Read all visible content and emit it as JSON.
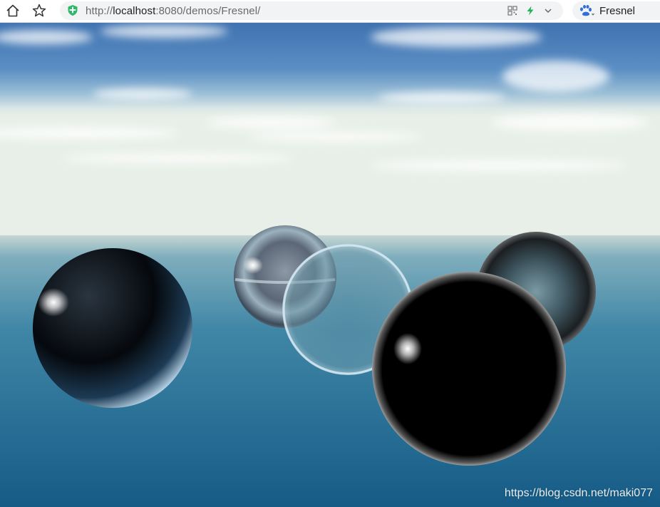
{
  "toolbar": {
    "home_icon": "home-icon",
    "favorite_icon": "star-icon",
    "security_icon": "shield-check-icon",
    "url_scheme": "http://",
    "url_host": "localhost",
    "url_rest": ":8080/demos/Fresnel/",
    "qr_icon": "qr-code-icon",
    "accelerate_icon": "lightning-icon",
    "dropdown_icon": "chevron-down-icon",
    "search_engine_icon": "baidu-paw-icon",
    "search_text": "Fresnel"
  },
  "scene": {
    "description_icon": "webgl-canvas",
    "sky_top": "#3f72b0",
    "sky_horizon": "#e8efe8",
    "water_far": "#6b9fb0",
    "water_near": "#175c86",
    "watermark": "https://blog.csdn.net/maki077"
  }
}
